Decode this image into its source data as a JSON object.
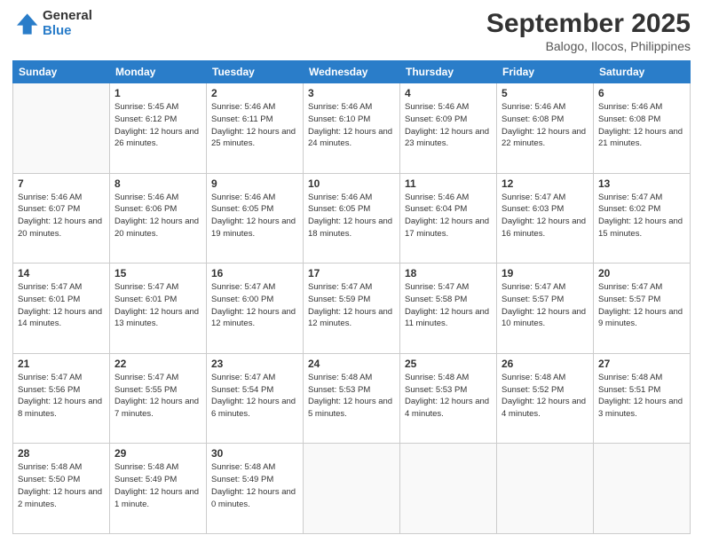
{
  "logo": {
    "general": "General",
    "blue": "Blue"
  },
  "title": "September 2025",
  "subtitle": "Balogo, Ilocos, Philippines",
  "days_header": [
    "Sunday",
    "Monday",
    "Tuesday",
    "Wednesday",
    "Thursday",
    "Friday",
    "Saturday"
  ],
  "weeks": [
    [
      {
        "day": "",
        "sunrise": "",
        "sunset": "",
        "daylight": ""
      },
      {
        "day": "1",
        "sunrise": "5:45 AM",
        "sunset": "6:12 PM",
        "daylight": "12 hours and 26 minutes."
      },
      {
        "day": "2",
        "sunrise": "5:46 AM",
        "sunset": "6:11 PM",
        "daylight": "12 hours and 25 minutes."
      },
      {
        "day": "3",
        "sunrise": "5:46 AM",
        "sunset": "6:10 PM",
        "daylight": "12 hours and 24 minutes."
      },
      {
        "day": "4",
        "sunrise": "5:46 AM",
        "sunset": "6:09 PM",
        "daylight": "12 hours and 23 minutes."
      },
      {
        "day": "5",
        "sunrise": "5:46 AM",
        "sunset": "6:08 PM",
        "daylight": "12 hours and 22 minutes."
      },
      {
        "day": "6",
        "sunrise": "5:46 AM",
        "sunset": "6:08 PM",
        "daylight": "12 hours and 21 minutes."
      }
    ],
    [
      {
        "day": "7",
        "sunrise": "5:46 AM",
        "sunset": "6:07 PM",
        "daylight": "12 hours and 20 minutes."
      },
      {
        "day": "8",
        "sunrise": "5:46 AM",
        "sunset": "6:06 PM",
        "daylight": "12 hours and 20 minutes."
      },
      {
        "day": "9",
        "sunrise": "5:46 AM",
        "sunset": "6:05 PM",
        "daylight": "12 hours and 19 minutes."
      },
      {
        "day": "10",
        "sunrise": "5:46 AM",
        "sunset": "6:05 PM",
        "daylight": "12 hours and 18 minutes."
      },
      {
        "day": "11",
        "sunrise": "5:46 AM",
        "sunset": "6:04 PM",
        "daylight": "12 hours and 17 minutes."
      },
      {
        "day": "12",
        "sunrise": "5:47 AM",
        "sunset": "6:03 PM",
        "daylight": "12 hours and 16 minutes."
      },
      {
        "day": "13",
        "sunrise": "5:47 AM",
        "sunset": "6:02 PM",
        "daylight": "12 hours and 15 minutes."
      }
    ],
    [
      {
        "day": "14",
        "sunrise": "5:47 AM",
        "sunset": "6:01 PM",
        "daylight": "12 hours and 14 minutes."
      },
      {
        "day": "15",
        "sunrise": "5:47 AM",
        "sunset": "6:01 PM",
        "daylight": "12 hours and 13 minutes."
      },
      {
        "day": "16",
        "sunrise": "5:47 AM",
        "sunset": "6:00 PM",
        "daylight": "12 hours and 12 minutes."
      },
      {
        "day": "17",
        "sunrise": "5:47 AM",
        "sunset": "5:59 PM",
        "daylight": "12 hours and 12 minutes."
      },
      {
        "day": "18",
        "sunrise": "5:47 AM",
        "sunset": "5:58 PM",
        "daylight": "12 hours and 11 minutes."
      },
      {
        "day": "19",
        "sunrise": "5:47 AM",
        "sunset": "5:57 PM",
        "daylight": "12 hours and 10 minutes."
      },
      {
        "day": "20",
        "sunrise": "5:47 AM",
        "sunset": "5:57 PM",
        "daylight": "12 hours and 9 minutes."
      }
    ],
    [
      {
        "day": "21",
        "sunrise": "5:47 AM",
        "sunset": "5:56 PM",
        "daylight": "12 hours and 8 minutes."
      },
      {
        "day": "22",
        "sunrise": "5:47 AM",
        "sunset": "5:55 PM",
        "daylight": "12 hours and 7 minutes."
      },
      {
        "day": "23",
        "sunrise": "5:47 AM",
        "sunset": "5:54 PM",
        "daylight": "12 hours and 6 minutes."
      },
      {
        "day": "24",
        "sunrise": "5:48 AM",
        "sunset": "5:53 PM",
        "daylight": "12 hours and 5 minutes."
      },
      {
        "day": "25",
        "sunrise": "5:48 AM",
        "sunset": "5:53 PM",
        "daylight": "12 hours and 4 minutes."
      },
      {
        "day": "26",
        "sunrise": "5:48 AM",
        "sunset": "5:52 PM",
        "daylight": "12 hours and 4 minutes."
      },
      {
        "day": "27",
        "sunrise": "5:48 AM",
        "sunset": "5:51 PM",
        "daylight": "12 hours and 3 minutes."
      }
    ],
    [
      {
        "day": "28",
        "sunrise": "5:48 AM",
        "sunset": "5:50 PM",
        "daylight": "12 hours and 2 minutes."
      },
      {
        "day": "29",
        "sunrise": "5:48 AM",
        "sunset": "5:49 PM",
        "daylight": "12 hours and 1 minute."
      },
      {
        "day": "30",
        "sunrise": "5:48 AM",
        "sunset": "5:49 PM",
        "daylight": "12 hours and 0 minutes."
      },
      {
        "day": "",
        "sunrise": "",
        "sunset": "",
        "daylight": ""
      },
      {
        "day": "",
        "sunrise": "",
        "sunset": "",
        "daylight": ""
      },
      {
        "day": "",
        "sunrise": "",
        "sunset": "",
        "daylight": ""
      },
      {
        "day": "",
        "sunrise": "",
        "sunset": "",
        "daylight": ""
      }
    ]
  ]
}
